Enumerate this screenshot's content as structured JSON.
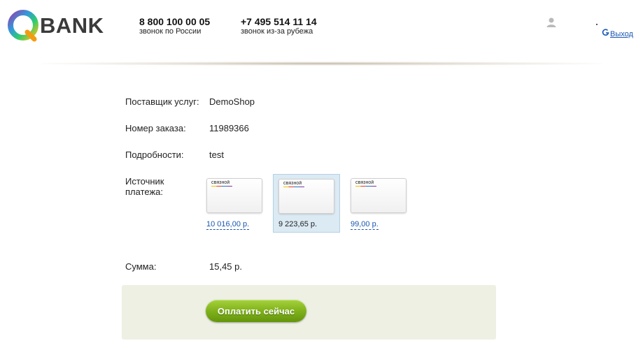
{
  "header": {
    "logo_text": "BANK",
    "phones": [
      {
        "number": "8 800 100 00 05",
        "caption": "звонок по России"
      },
      {
        "number": "+7 495 514 11 14",
        "caption": "звонок из-за рубежа"
      }
    ],
    "logout_label": "Выход"
  },
  "form": {
    "provider": {
      "label": "Поставщик услуг:",
      "value": "DemoShop"
    },
    "order": {
      "label": "Номер заказа:",
      "value": "11989366"
    },
    "details": {
      "label": "Подробности:",
      "value": "test"
    },
    "source": {
      "label_line1": "Источник",
      "label_line2": "платежа:",
      "cards": [
        {
          "brand": "СВЯЗНОЙ",
          "amount": "10 016,00 р.",
          "selected": false
        },
        {
          "brand": "СВЯЗНОЙ",
          "amount": "9 223,65 р.",
          "selected": true
        },
        {
          "brand": "СВЯЗНОЙ",
          "amount": "99,00 р.",
          "selected": false
        }
      ]
    },
    "sum": {
      "label": "Сумма:",
      "value": "15,45 р."
    }
  },
  "pay_button_label": "Оплатить сейчас",
  "colors": {
    "link": "#1a56b0",
    "pay_button": "#7fb21b",
    "selected_card_bg": "#dbeaf3",
    "pay_panel_bg": "#edf0e3"
  }
}
